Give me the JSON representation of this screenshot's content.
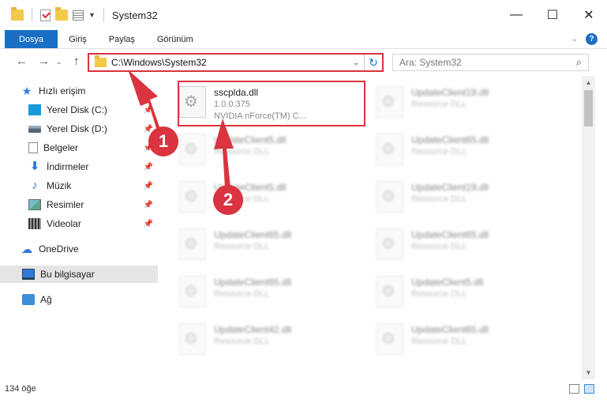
{
  "window": {
    "title": "System32",
    "minimize": "—",
    "maximize": "☐",
    "close": "✕"
  },
  "ribbon": {
    "tabs": [
      "Dosya",
      "Giriş",
      "Paylaş",
      "Görünüm"
    ],
    "help": "?"
  },
  "nav": {
    "back": "←",
    "forward": "→",
    "up": "↑",
    "address": "C:\\Windows\\System32",
    "search_placeholder": "Ara: System32"
  },
  "sidebar": {
    "items": [
      {
        "label": "Hızlı erişim",
        "icon": "star-icon"
      },
      {
        "label": "Yerel Disk (C:)",
        "icon": "disk-icon"
      },
      {
        "label": "Yerel Disk (D:)",
        "icon": "disk-icon"
      },
      {
        "label": "Belgeler",
        "icon": "document-icon"
      },
      {
        "label": "İndirmeler",
        "icon": "download-icon"
      },
      {
        "label": "Müzik",
        "icon": "music-icon"
      },
      {
        "label": "Resimler",
        "icon": "pictures-icon"
      },
      {
        "label": "Videolar",
        "icon": "videos-icon"
      },
      {
        "label": "OneDrive",
        "icon": "cloud-icon"
      },
      {
        "label": "Bu bilgisayar",
        "icon": "computer-icon"
      },
      {
        "label": "Ağ",
        "icon": "network-icon"
      }
    ]
  },
  "files": {
    "highlighted": {
      "name": "sscplda.dll",
      "version": "1.0.0.375",
      "description": "NVIDIA nForce(TM) C..."
    },
    "left_column": [
      {
        "name": "UpdateClient5.dll",
        "type": "Resource DLL"
      },
      {
        "name": "UpdateClient5.dll",
        "type": "Resource DLL"
      },
      {
        "name": "UpdateClient65.dll",
        "type": "Resource DLL"
      },
      {
        "name": "UpdateClient65.dll",
        "type": "Resource DLL"
      },
      {
        "name": "UpdateClient42.dll",
        "type": "Resource DLL"
      }
    ],
    "right_column": [
      {
        "name": "UpdateClient19.dll",
        "type": "Resource DLL"
      },
      {
        "name": "UpdateClient65.dll",
        "type": "Resource DLL"
      },
      {
        "name": "UpdateClient19.dll",
        "type": "Resource DLL"
      },
      {
        "name": "UpdateClient65.dll",
        "type": "Resource DLL"
      },
      {
        "name": "UpdateClient5.dll",
        "type": "Resource DLL"
      },
      {
        "name": "UpdateClient65.dll",
        "type": "Resource DLL"
      }
    ]
  },
  "status": {
    "count": "134 öğe"
  },
  "callouts": {
    "one": "1",
    "two": "2",
    "color": "#d9343f"
  }
}
